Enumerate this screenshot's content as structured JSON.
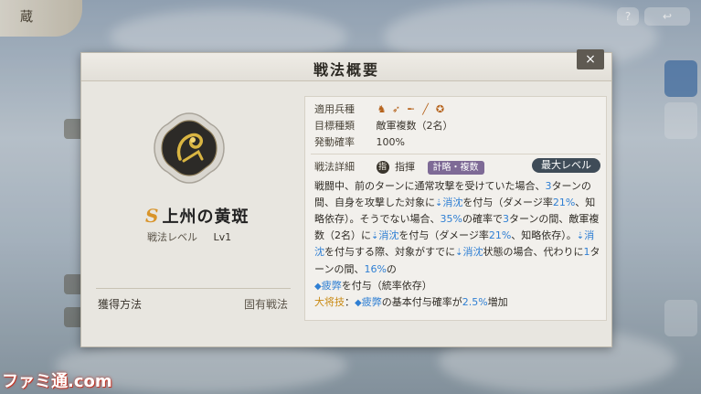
{
  "top_left": {
    "label": "蔵"
  },
  "top_buttons": [
    "?",
    "↩"
  ],
  "modal": {
    "title": "戦法概要",
    "close_label": "×"
  },
  "skill": {
    "grade": "S",
    "name": "上州の黄斑",
    "level_label": "戦法レベル",
    "level_value": "Lv1",
    "acquire_label": "獲得方法",
    "acquire_value": "固有戦法"
  },
  "info": {
    "troop_label": "適用兵種",
    "troop_icons": [
      "cavalry-icon",
      "bow-icon",
      "gun-icon",
      "spear-icon",
      "shield-icon"
    ],
    "target_label": "目標種類",
    "target_value": "敵軍複数（2名）",
    "rate_label": "発動確率",
    "rate_value": "100%",
    "detail_label": "戦法詳細",
    "command_icon_text": "指",
    "command_label": "指揮",
    "tag": "計略・複数",
    "max_level_label": "最大レベル"
  },
  "description": {
    "p1_a": "戦闘中、前のターンに通常攻撃を受けていた場合、",
    "p1_n1": "3",
    "p1_b": "ターンの間、自身を攻撃した対象に",
    "p1_k1": "消沈",
    "p1_c": "を付与（ダメージ率",
    "p1_r1": "21%",
    "p1_d": "、知略依存）。そうでない場合、",
    "p1_r2": "35%",
    "p1_e": "の確率で",
    "p1_n2": "3",
    "p1_f": "ターンの間、敵軍複数（2名）に",
    "p1_k2": "消沈",
    "p1_g": "を付与（ダメージ率",
    "p1_r3": "21%",
    "p1_h": "、知略依存）。",
    "p1_k3": "消沈",
    "p1_i": "を付与する際、対象がすでに",
    "p1_k4": "消沈",
    "p1_j": "状態の場合、代わりに",
    "p1_n3": "1",
    "p1_k": "ターンの間、",
    "p1_r4": "16%",
    "p1_l": "の",
    "p1_k5": "疲弊",
    "p1_m": "を付与（統率依存）",
    "p2_label": "大将技",
    "p2_a": "：",
    "p2_k": "疲弊",
    "p2_b": "の基本付与確率が",
    "p2_r": "2.5%",
    "p2_c": "増加"
  },
  "watermark": "ファミ通.com",
  "colors": {
    "highlight": "#2f7fd3",
    "gold": "#c98a14",
    "tag": "#7e6a96",
    "max_button": "#3f4c58"
  }
}
